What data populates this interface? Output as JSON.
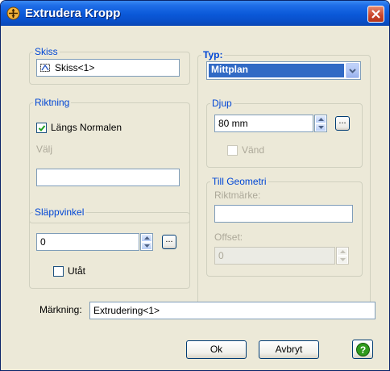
{
  "window": {
    "title": "Extrudera Kropp"
  },
  "skiss": {
    "legend": "Skiss",
    "value": "Skiss<1>"
  },
  "riktning": {
    "legend": "Riktning",
    "normal_label": "Längs Normalen",
    "normal_checked": true,
    "valj_label": "Välj",
    "valj_value": ""
  },
  "slappvinkel": {
    "legend": "Släppvinkel",
    "value": "0",
    "browse_label": "...",
    "utat_label": "Utåt",
    "utat_checked": false
  },
  "typ": {
    "legend": "Typ:",
    "value": "Mittplan"
  },
  "djup": {
    "legend": "Djup",
    "value": "80 mm",
    "browse_label": "...",
    "vand_label": "Vänd",
    "vand_checked": false
  },
  "till_geometri": {
    "legend": "Till Geometri",
    "riktmarke_label": "Riktmärke:",
    "riktmarke_value": "",
    "offset_label": "Offset:",
    "offset_value": "0"
  },
  "markning": {
    "label": "Märkning:",
    "value": "Extrudering<1>"
  },
  "buttons": {
    "ok": "Ok",
    "cancel": "Avbryt",
    "help": "?"
  },
  "colors": {
    "title_bar": "#0a58d8",
    "group_legend": "#0046d5",
    "selection": "#316ac5",
    "help_icon": "#2f9a1c"
  }
}
